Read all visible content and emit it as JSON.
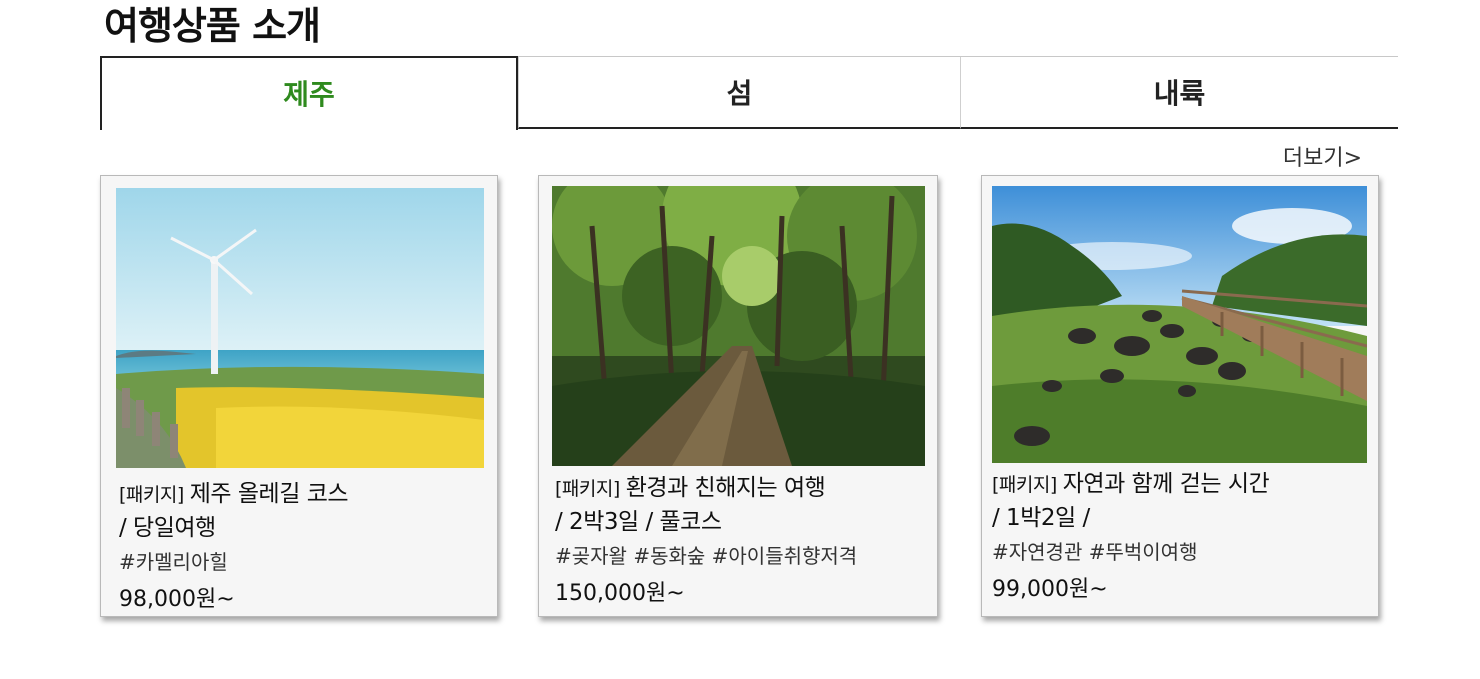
{
  "section": {
    "title": "여행상품 소개"
  },
  "tabs": [
    {
      "label": "제주"
    },
    {
      "label": "섬"
    },
    {
      "label": "내륙"
    }
  ],
  "more_link": "더보기>",
  "colors": {
    "active_tab": "#2f8a1e",
    "card_bg": "#f6f6f6",
    "border": "#222222"
  },
  "products": [
    {
      "tag": "[패키지]",
      "title_line1": "제주 올레길 코스",
      "title_line2": "/ 당일여행",
      "hashtags": "#카멜리아힐",
      "price": "98,000원~",
      "image": "wind-turbine-flower-field"
    },
    {
      "tag": "[패키지]",
      "title_line1": "환경과 친해지는 여행",
      "title_line2": "/ 2박3일 / 풀코스",
      "hashtags": "#곶자왈 #동화숲 #아이들취향저격",
      "price": "150,000원~",
      "image": "forest-path"
    },
    {
      "tag": "[패키지]",
      "title_line1": "자연과 함께 걷는 시간",
      "title_line2": "/ 1박2일 /",
      "hashtags": "#자연경관 #뚜벅이여행",
      "price": "99,000원~",
      "image": "rocky-meadow-boardwalk"
    }
  ]
}
